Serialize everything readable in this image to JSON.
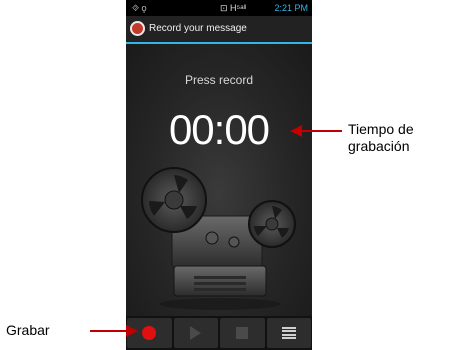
{
  "status_bar": {
    "left_icons": "⯑ ⚲",
    "mid": "⊡ H⁵ᵃˡˡ",
    "time": "2:21 PM"
  },
  "title_bar": {
    "title": "Record your message"
  },
  "recorder": {
    "status": "Press record",
    "time": "00:00"
  },
  "controls": [
    {
      "name": "record",
      "icon": "record-icon"
    },
    {
      "name": "play",
      "icon": "play-icon"
    },
    {
      "name": "stop",
      "icon": "stop-icon"
    },
    {
      "name": "list",
      "icon": "list-icon"
    }
  ],
  "annotations": {
    "right_label_line1": "Tiempo de",
    "right_label_line2": "grabación",
    "left_label": "Grabar"
  },
  "colors": {
    "accent": "#33b5e5",
    "record": "#e11010",
    "arrow": "#c00000"
  }
}
